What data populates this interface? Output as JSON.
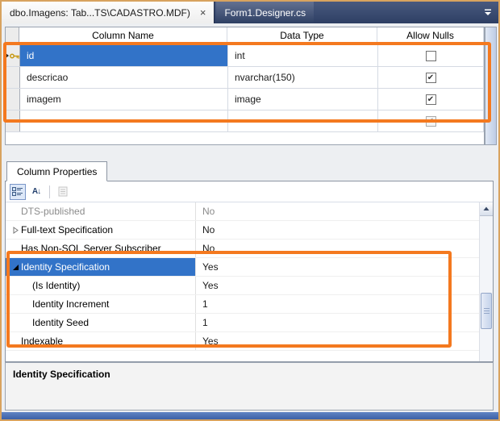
{
  "colors": {
    "selection_blue": "#3273c8",
    "annotation_orange": "#f4791f",
    "tab_bar_blue": "#2e3f63",
    "status_bar_blue": "#4a6fb5",
    "window_border_tan": "#d8a35f"
  },
  "tab_bar": {
    "active_tab_label": "dbo.Imagens: Tab...TS\\CADASTRO.MDF)",
    "close_glyph": "×",
    "inactive_tab_label": "Form1.Designer.cs"
  },
  "columns_grid": {
    "headers": [
      "Column Name",
      "Data Type",
      "Allow Nulls"
    ],
    "rows": [
      {
        "name": "id",
        "type": "int",
        "checked": false,
        "key": true,
        "selected": true
      },
      {
        "name": "descricao",
        "type": "nvarchar(150)",
        "checked": true
      },
      {
        "name": "imagem",
        "type": "image",
        "checked": true
      },
      {
        "name": "",
        "type": "",
        "checked": true,
        "new_row": true
      }
    ]
  },
  "properties": {
    "tab_label": "Column Properties",
    "rows": [
      {
        "name": "DTS-published",
        "value": "No",
        "disabled": true
      },
      {
        "name": "Full-text Specification",
        "value": "No",
        "collapsed": true
      },
      {
        "name": "Has Non-SQL Server Subscriber",
        "value": "No"
      },
      {
        "name": "Identity Specification",
        "value": "Yes",
        "expanded": true,
        "selected": true
      },
      {
        "name": "(Is Identity)",
        "value": "Yes",
        "child": true
      },
      {
        "name": "Identity Increment",
        "value": "1",
        "child": true
      },
      {
        "name": "Identity Seed",
        "value": "1",
        "child": true
      },
      {
        "name": "Indexable",
        "value": "Yes"
      }
    ],
    "description_title": "Identity Specification"
  },
  "icons": {
    "check_glyph": "✔",
    "sort_az_glyph": "A↓"
  }
}
